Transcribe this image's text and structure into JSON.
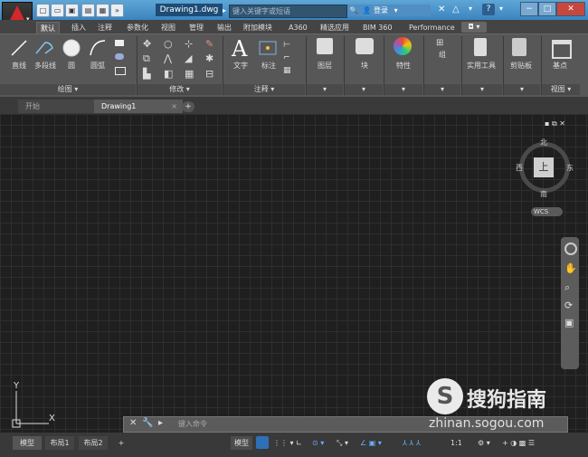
{
  "title": {
    "document_name": "Drawing1.dwg",
    "search_placeholder": "键入关键字或短语",
    "login_label": "登录"
  },
  "ribbon_tabs": [
    "默认",
    "插入",
    "注释",
    "参数化",
    "视图",
    "管理",
    "输出",
    "附加模块",
    "A360",
    "精选应用",
    "BIM 360",
    "Performance"
  ],
  "ribbon": {
    "draw_tools": {
      "line": "直线",
      "polyline": "多段线",
      "circle": "圆",
      "arc": "圆弧"
    },
    "panel_draw": "绘图 ▾",
    "panel_modify": "修改 ▾",
    "text": "文字",
    "dimension": "标注",
    "panel_annotation": "注释 ▾",
    "layers": "图层",
    "block": "块",
    "properties": "特性",
    "group": "组",
    "utilities": "实用工具",
    "clipboard": "剪贴板",
    "base": "基点",
    "panel_view": "视图 ▾"
  },
  "file_tabs": {
    "start": "开始",
    "drawing": "Drawing1",
    "add": "+"
  },
  "viewcube": {
    "north": "北",
    "south": "南",
    "east": "东",
    "west": "西",
    "top": "上",
    "wcs": "WCS"
  },
  "ucs": {
    "x": "X",
    "y": "Y"
  },
  "command": {
    "placeholder": "键入命令"
  },
  "layout_tabs": [
    "模型",
    "布局1",
    "布局2"
  ],
  "layout_add": "+",
  "status": {
    "model": "模型",
    "scale": "1:1"
  },
  "watermark": {
    "brand": "搜狗指南",
    "url": "zhinan.sogou.com"
  },
  "colors": {
    "accent": "#2f6fb5",
    "autocad_red": "#d3282b",
    "canvas": "#1f1f1f"
  }
}
